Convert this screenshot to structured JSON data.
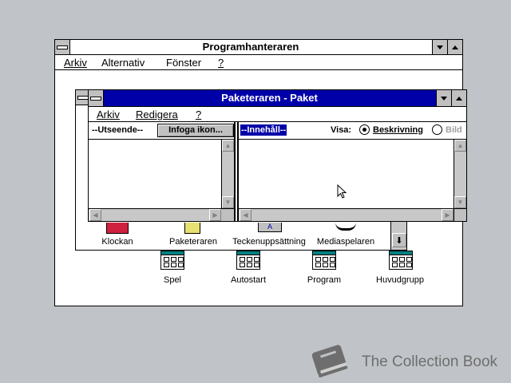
{
  "program_manager": {
    "title": "Programhanteraren",
    "menu": [
      "Arkiv",
      "Alternativ",
      "Fönster",
      "?"
    ]
  },
  "group_window": {
    "icons": [
      "Klockan",
      "Paketeraren",
      "Teckenuppsättning",
      "Mediaspelaren"
    ]
  },
  "group_icons": [
    "Spel",
    "Autostart",
    "Program",
    "Huvudgrupp"
  ],
  "packager": {
    "title": "Paketeraren - Paket",
    "menu": [
      "Arkiv",
      "Redigera",
      "?"
    ],
    "appearance_label": "--Utseende--",
    "insert_icon_button": "Infoga ikon...",
    "content_label": "--Innehåll--",
    "view_label": "Visa:",
    "view_options": [
      "Beskrivning",
      "Bild"
    ],
    "view_selected": "Beskrivning"
  },
  "watermark": {
    "text": "The Collection Book",
    "icon": "book-icon"
  },
  "colors": {
    "desktop": "#c0c4c8",
    "active_title": "#0000a8",
    "selection": "#0000a8",
    "group_icon_header": "#008080"
  }
}
